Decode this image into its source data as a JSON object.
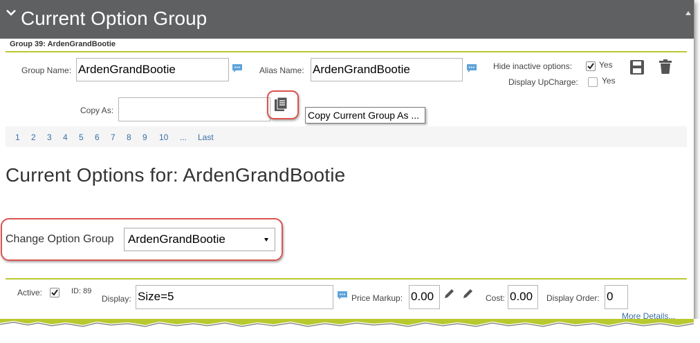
{
  "header": {
    "title": "Current Option Group"
  },
  "group_line": "Group 39: ArdenGrandBootie",
  "form": {
    "group_name_label": "Group Name:",
    "group_name_value": "ArdenGrandBootie",
    "alias_name_label": "Alias Name:",
    "alias_name_value": "ArdenGrandBootie",
    "hide_inactive_label": "Hide inactive options:",
    "hide_inactive_yes": "Yes",
    "hide_inactive_checked": true,
    "display_upcharge_label": "Display UpCharge:",
    "display_upcharge_yes": "Yes",
    "display_upcharge_checked": false,
    "copy_as_label": "Copy As:",
    "copy_as_value": "",
    "copy_tooltip": "Copy Current Group As ..."
  },
  "pagination": [
    "1",
    "2",
    "3",
    "4",
    "5",
    "6",
    "7",
    "8",
    "9",
    "10",
    "...",
    "Last"
  ],
  "current_options_heading": "Current Options for: ArdenGrandBootie",
  "change_group": {
    "label": "Change Option Group",
    "selected": "ArdenGrandBootie"
  },
  "option_row": {
    "active_label": "Active:",
    "active_checked": true,
    "id_text": "ID: 89",
    "display_label": "Display:",
    "display_value": "Size=5",
    "price_markup_label": "Price Markup:",
    "price_markup_value": "0.00",
    "cost_label": "Cost:",
    "cost_value": "0.00",
    "display_order_label": "Display Order:",
    "display_order_value": "0",
    "more_details": "More Details..."
  },
  "colors": {
    "titlebar": "#5f6062",
    "accent_rule": "#b8c92f",
    "link": "#3a6ea5",
    "highlight_ring": "#d9534f"
  },
  "icons": [
    "chevron-down-icon",
    "comment-icon",
    "save-icon",
    "trash-icon",
    "copy-icon",
    "pencil-icon",
    "dropdown-arrow-icon"
  ]
}
